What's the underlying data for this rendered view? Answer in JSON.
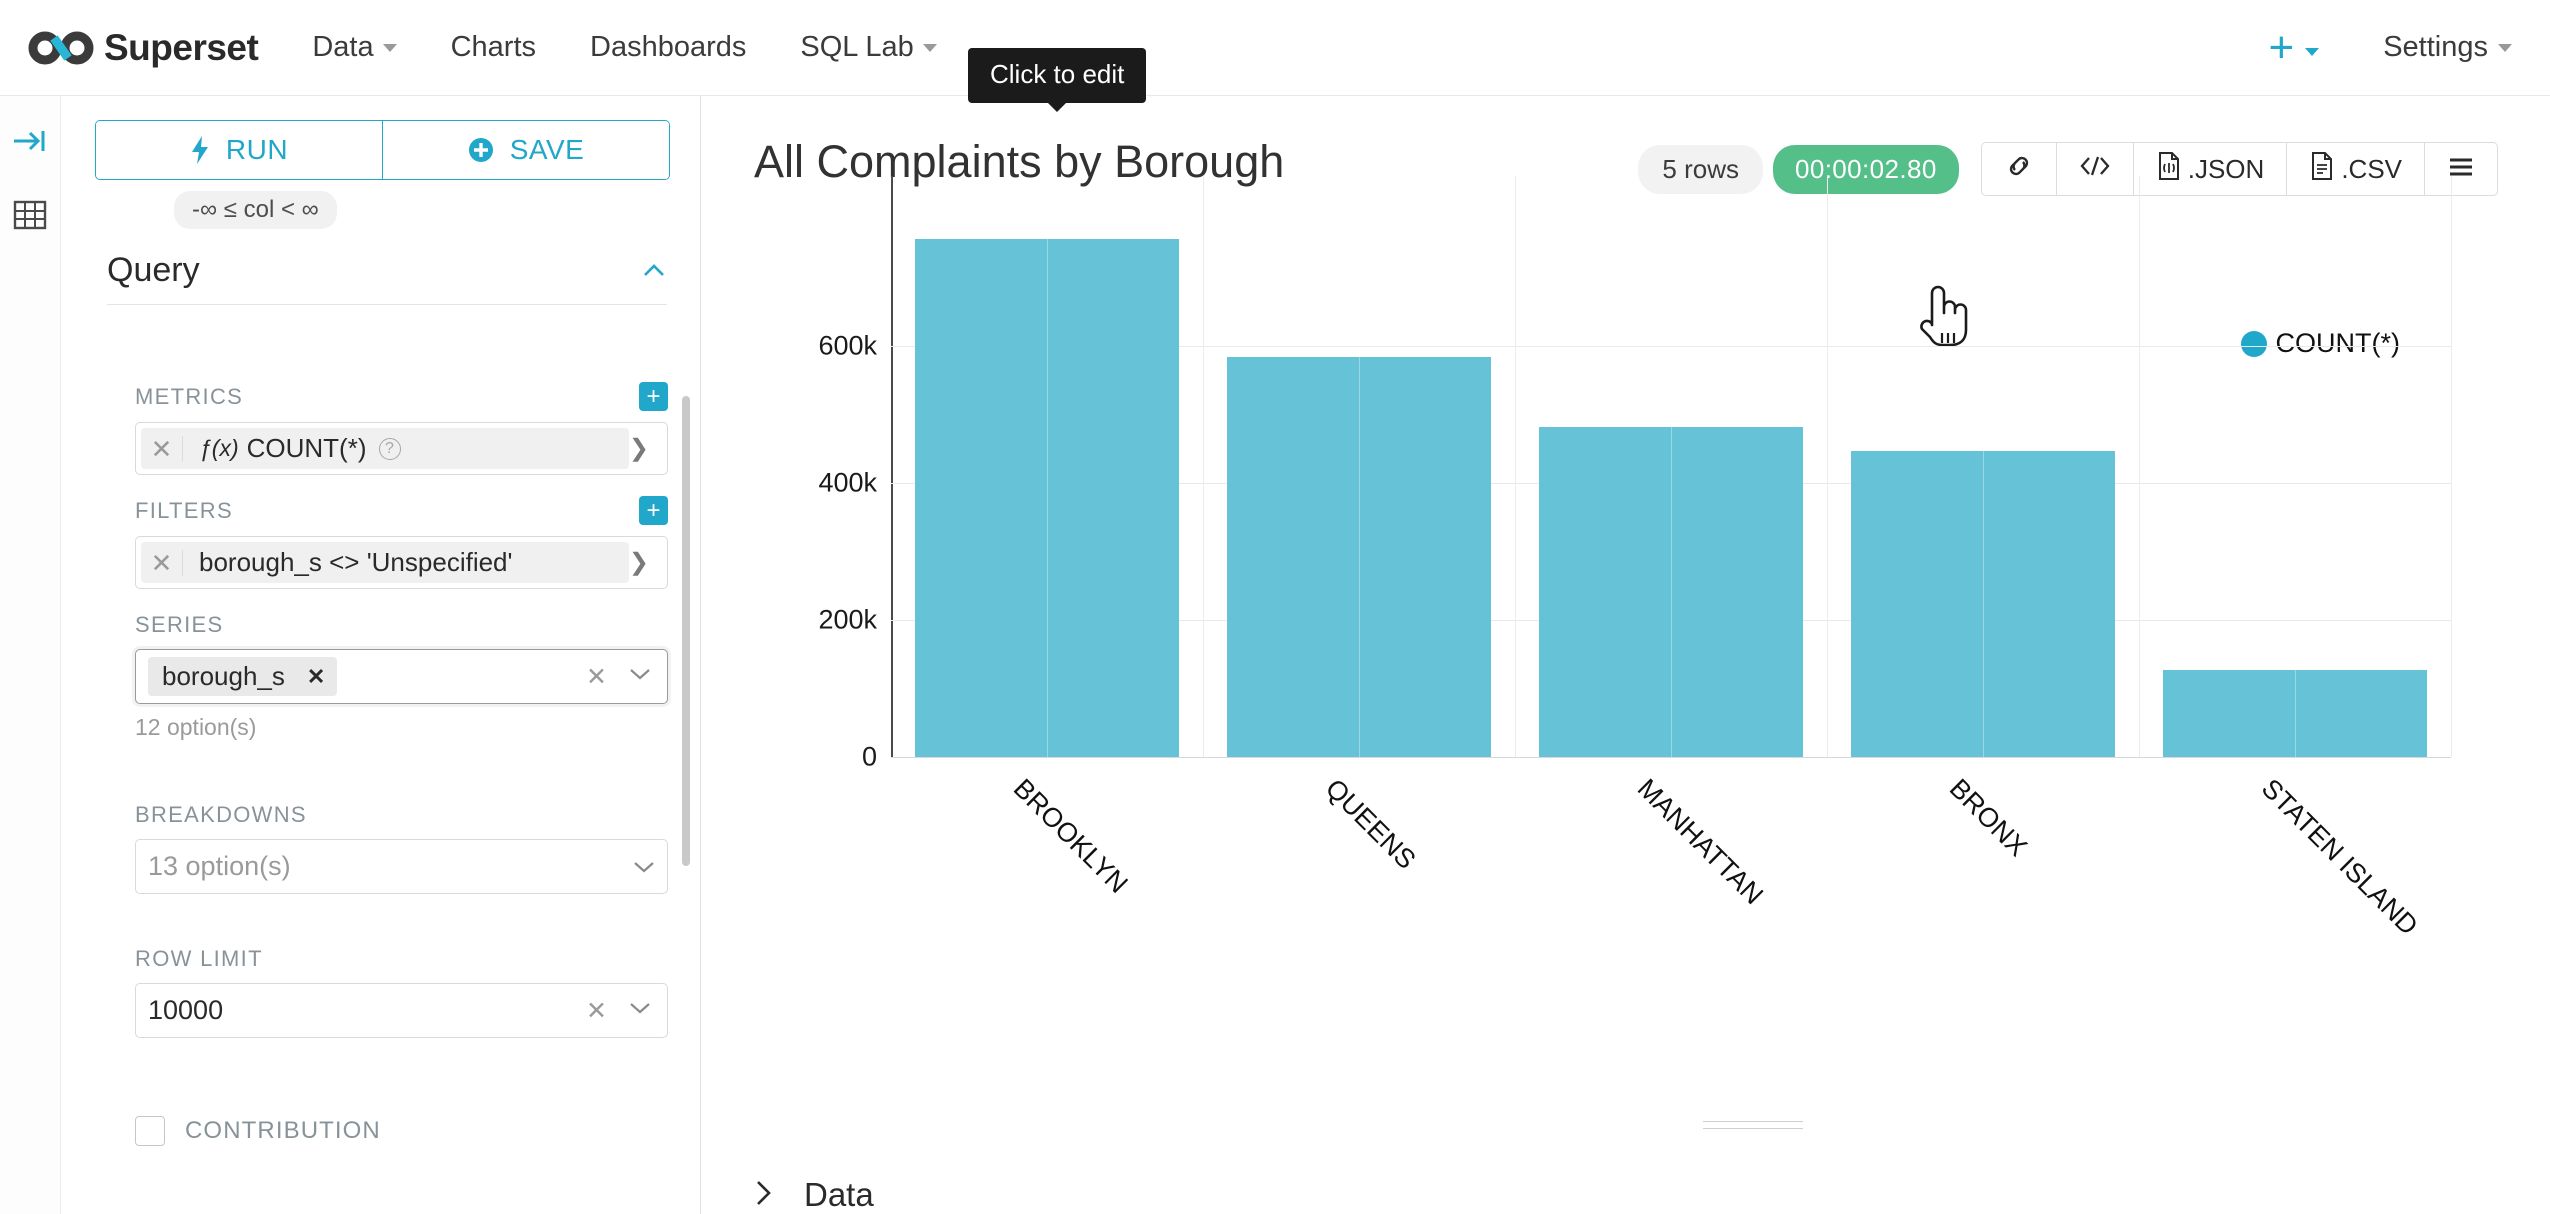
{
  "navbar": {
    "brand": "Superset",
    "brand_logo_icon": "infinity-logo-icon",
    "items": [
      {
        "label": "Data",
        "has_caret": true
      },
      {
        "label": "Charts",
        "has_caret": false
      },
      {
        "label": "Dashboards",
        "has_caret": false
      },
      {
        "label": "SQL Lab",
        "has_caret": true
      }
    ],
    "plus_label": "+",
    "settings_label": "Settings"
  },
  "tooltip": {
    "text": "Click to edit"
  },
  "rail": {
    "collapse_icon": "expand-panel-icon",
    "table_icon": "table-grid-icon"
  },
  "panel": {
    "run_label": "RUN",
    "run_icon": "lightning-bolt-icon",
    "save_label": "SAVE",
    "save_icon": "plus-circle-icon",
    "range_pill": "-∞ ≤ col < ∞",
    "query_header": "Query",
    "collapse_icon": "chevron-up-icon",
    "metrics": {
      "label": "METRICS",
      "add_label": "+",
      "value": "COUNT(*)",
      "fx_label": "ƒ(x)",
      "help_icon": "question-circle-icon",
      "remove_icon": "close-icon",
      "expand_icon": "chevron-right-icon"
    },
    "filters": {
      "label": "FILTERS",
      "add_label": "+",
      "value": "borough_s <> 'Unspecified'",
      "remove_icon": "close-icon",
      "expand_icon": "chevron-right-icon"
    },
    "series": {
      "label": "SERIES",
      "tag": "borough_s",
      "tag_remove_icon": "close-icon",
      "clear_icon": "clear-icon",
      "dropdown_icon": "chevron-down-icon",
      "hint": "12 option(s)"
    },
    "breakdowns": {
      "label": "BREAKDOWNS",
      "placeholder": "13 option(s)",
      "dropdown_icon": "chevron-down-icon"
    },
    "row_limit": {
      "label": "ROW LIMIT",
      "value": "10000",
      "clear_icon": "clear-icon",
      "dropdown_icon": "chevron-down-icon"
    },
    "contribution": {
      "label": "CONTRIBUTION",
      "checked": false
    }
  },
  "chart_header": {
    "title": "All Complaints by Borough",
    "cursor_icon": "pointing-hand-cursor-icon",
    "rows_badge": "5 rows",
    "timer": "00:00:02.80",
    "timer_color": "#55bf8a",
    "buttons": [
      {
        "name": "share-link",
        "icon": "link-icon",
        "label": ""
      },
      {
        "name": "view-query",
        "icon": "code-icon",
        "label": ""
      },
      {
        "name": "export-json",
        "icon": "file-icon",
        "label": ".JSON"
      },
      {
        "name": "export-csv",
        "icon": "file-icon",
        "label": ".CSV"
      },
      {
        "name": "more-options",
        "icon": "hamburger-icon",
        "label": ""
      }
    ]
  },
  "footer": {
    "data_label": "Data",
    "expand_icon": "chevron-right-icon"
  },
  "chart_data": {
    "type": "bar",
    "title": "All Complaints by Borough",
    "xlabel": "",
    "ylabel": "",
    "categories": [
      "BROOKLYN",
      "QUEENS",
      "MANHATTAN",
      "BRONX",
      "STATEN ISLAND"
    ],
    "values": [
      756000,
      584000,
      481000,
      447000,
      127000
    ],
    "series": [
      {
        "name": "COUNT(*)",
        "color": "#66c2d7",
        "values": [
          756000,
          584000,
          481000,
          447000,
          127000
        ]
      }
    ],
    "ylim": [
      0,
      760000
    ],
    "yticks": [
      0,
      200000,
      400000,
      600000
    ],
    "ytick_labels": [
      "0",
      "200k",
      "400k",
      "600k"
    ],
    "grid": true,
    "legend": {
      "position": "top-right",
      "entries": [
        "COUNT(*)"
      ],
      "color": "#1fa8c9"
    },
    "xtick_rotation": 45
  }
}
